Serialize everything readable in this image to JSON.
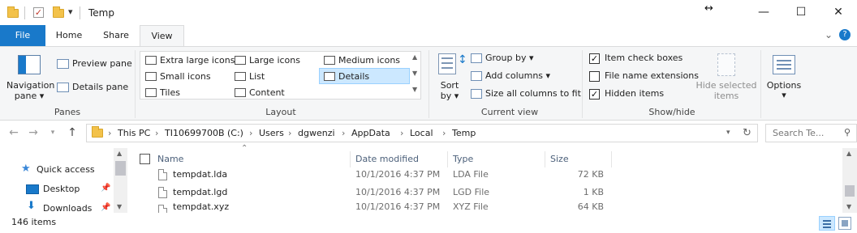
{
  "title_bar": {
    "title": "Temp",
    "qat_dropdown": "▾",
    "resize_cursor": "↔",
    "minimize": "—",
    "maximize": "☐",
    "close": "✕"
  },
  "ribbon_tabs": {
    "file": "File",
    "home": "Home",
    "share": "Share",
    "view": "View",
    "collapse": "⌄",
    "help": "?"
  },
  "panes_group": {
    "label": "Panes",
    "navigation_pane_line1": "Navigation",
    "navigation_pane_line2": "pane ▾",
    "preview_pane": "Preview pane",
    "details_pane": "Details pane"
  },
  "layout_group": {
    "label": "Layout",
    "extra_large_icons": "Extra large icons",
    "large_icons": "Large icons",
    "medium_icons": "Medium icons",
    "small_icons": "Small icons",
    "list": "List",
    "details": "Details",
    "tiles": "Tiles",
    "content": "Content",
    "selected": "Details"
  },
  "current_view_group": {
    "label": "Current view",
    "sort_by_line1": "Sort",
    "sort_by_line2": "by ▾",
    "group_by": "Group by ▾",
    "add_columns": "Add columns ▾",
    "size_all_columns": "Size all columns to fit"
  },
  "show_hide_group": {
    "label": "Show/hide",
    "item_check_boxes": "Item check boxes",
    "item_check_boxes_checked": true,
    "file_name_extensions": "File name extensions",
    "file_name_extensions_checked": false,
    "hidden_items": "Hidden items",
    "hidden_items_checked": true,
    "hide_selected_items_line1": "Hide selected",
    "hide_selected_items_line2": "items"
  },
  "options_group": {
    "options": "Options",
    "options_arrow": "▾"
  },
  "address_bar": {
    "breadcrumbs": [
      "This PC",
      "TI10699700B (C:)",
      "Users",
      "dgwenzi",
      "AppData",
      "Local",
      "Temp"
    ],
    "search_placeholder": "Search Te..."
  },
  "nav_pane": {
    "items": [
      {
        "label": "Quick access",
        "icon": "star-icon"
      },
      {
        "label": "Desktop",
        "icon": "desktop-icon"
      },
      {
        "label": "Downloads",
        "icon": "download-icon"
      }
    ]
  },
  "file_list": {
    "columns": [
      "Name",
      "Date modified",
      "Type",
      "Size"
    ],
    "rows": [
      {
        "name": "tempdat.lda",
        "date": "10/1/2016 4:37 PM",
        "type": "LDA File",
        "size": "72 KB"
      },
      {
        "name": "tempdat.lgd",
        "date": "10/1/2016 4:37 PM",
        "type": "LGD File",
        "size": "1 KB"
      },
      {
        "name": "tempdat.xyz",
        "date": "10/1/2016 4:37 PM",
        "type": "XYZ File",
        "size": "64 KB"
      }
    ]
  },
  "status_bar": {
    "item_count": "146 items"
  },
  "colors": {
    "file_tab": "#1979ca",
    "selection": "#cce8ff",
    "folder": "#f3c24a",
    "ribbon_bg": "#f5f6f7"
  }
}
